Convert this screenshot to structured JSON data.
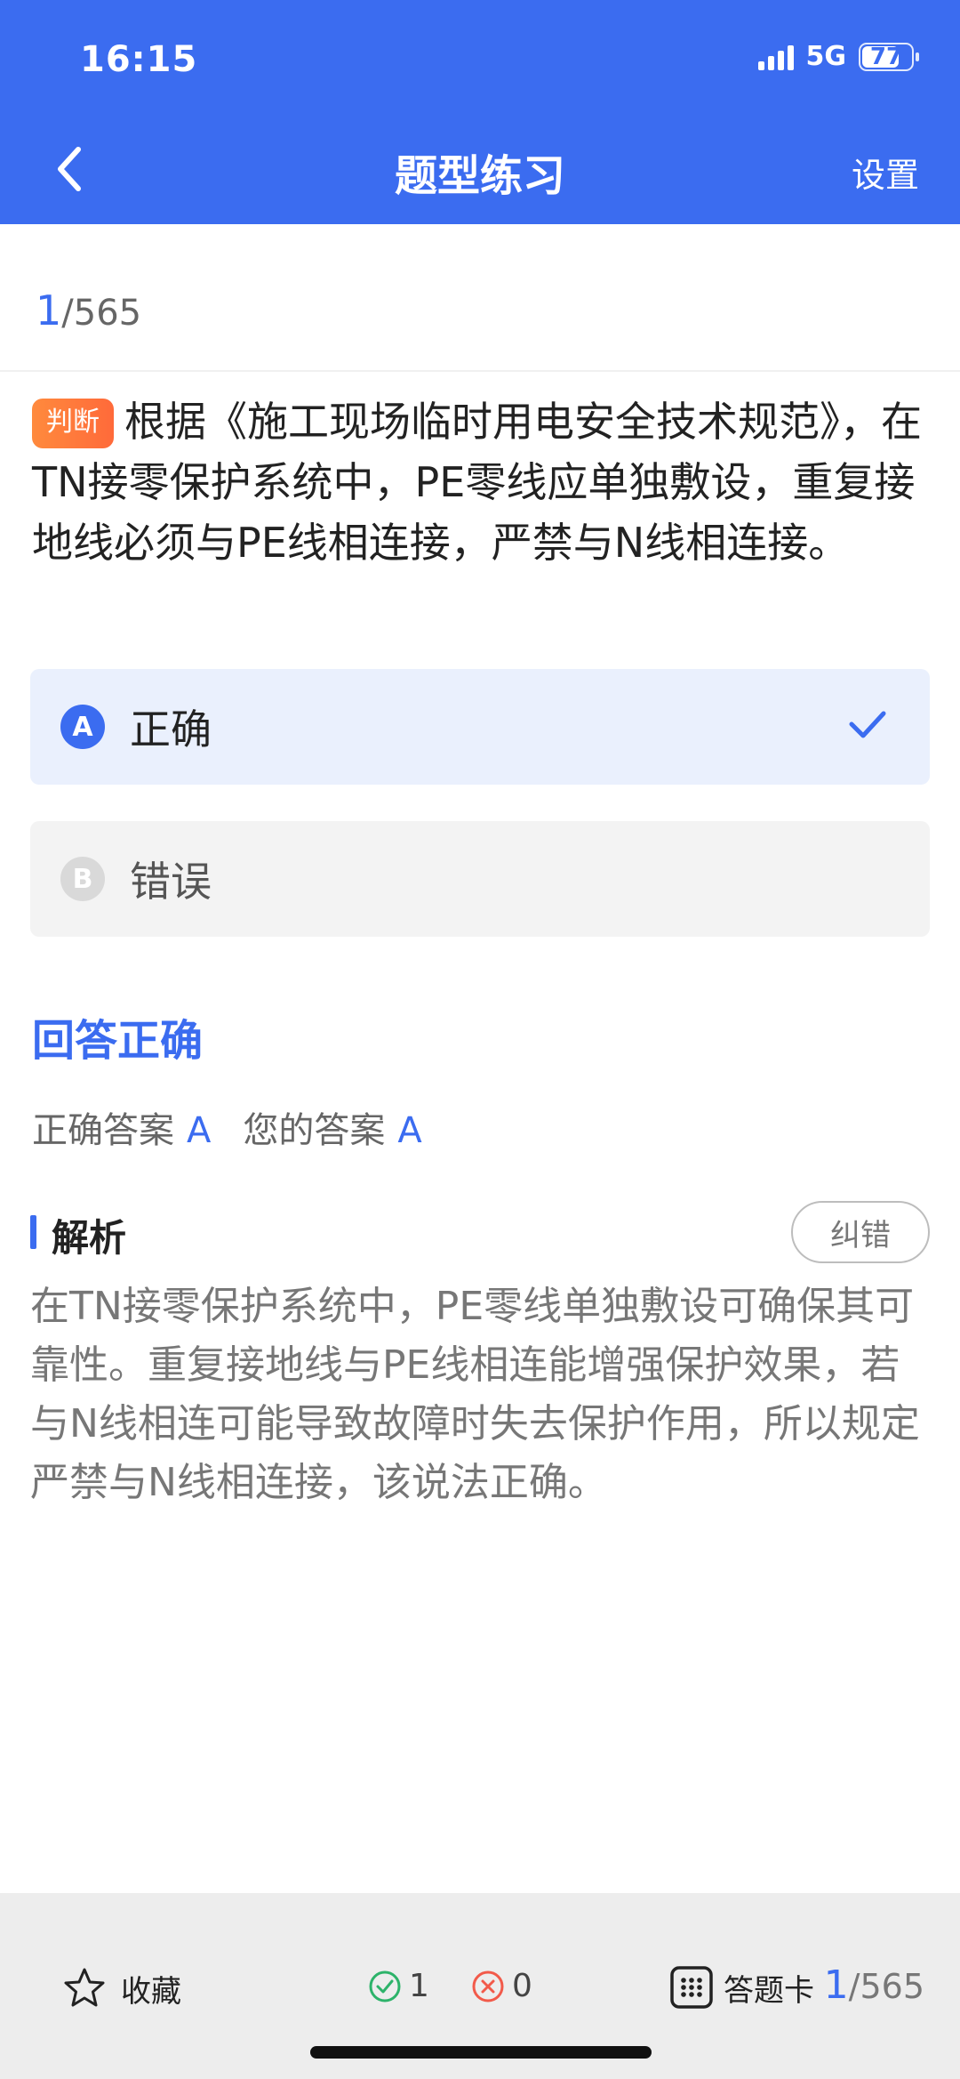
{
  "status_bar": {
    "time": "16:15",
    "network": "5G",
    "battery": "77",
    "battery_level_percent": 77
  },
  "nav": {
    "title": "题型练习",
    "settings_label": "设置"
  },
  "progress": {
    "current": "1",
    "total_text": "/565"
  },
  "question": {
    "type_tag": "判断",
    "text": "根据《施工现场临时用电安全技术规范》，在TN接零保护系统中，PE零线应单独敷设，重复接地线必须与PE线相连接，严禁与N线相连接。"
  },
  "options": [
    {
      "letter": "A",
      "text": "正确",
      "selected": true
    },
    {
      "letter": "B",
      "text": "错误",
      "selected": false
    }
  ],
  "result": {
    "title": "回答正确",
    "correct_label": "正确答案",
    "correct_value": "A",
    "yours_label": "您的答案",
    "yours_value": "A"
  },
  "analysis": {
    "title": "解析",
    "correction_label": "纠错",
    "text": "在TN接零保护系统中，PE零线单独敷设可确保其可靠性。重复接地线与PE线相连能增强保护效果，若与N线相连可能导致故障时失去保护作用，所以规定严禁与N线相连接，该说法正确。"
  },
  "bottom_bar": {
    "favorite_label": "收藏",
    "correct_count": "1",
    "wrong_count": "0",
    "card_label": "答题卡",
    "progress_current": "1",
    "progress_total_text": "/565"
  },
  "icons": {
    "back": "chevron-left-icon",
    "check": "checkmark-icon",
    "favorite": "star-outline-icon",
    "correct": "check-circle-icon",
    "wrong": "x-circle-icon",
    "card": "grid-icon"
  },
  "colors": {
    "primary": "#3B6CF0",
    "tag_orange": "#FF7A3C",
    "selected_bg": "#EAF0FD",
    "correct_green": "#2DB36A",
    "wrong_red": "#F25A4A"
  }
}
